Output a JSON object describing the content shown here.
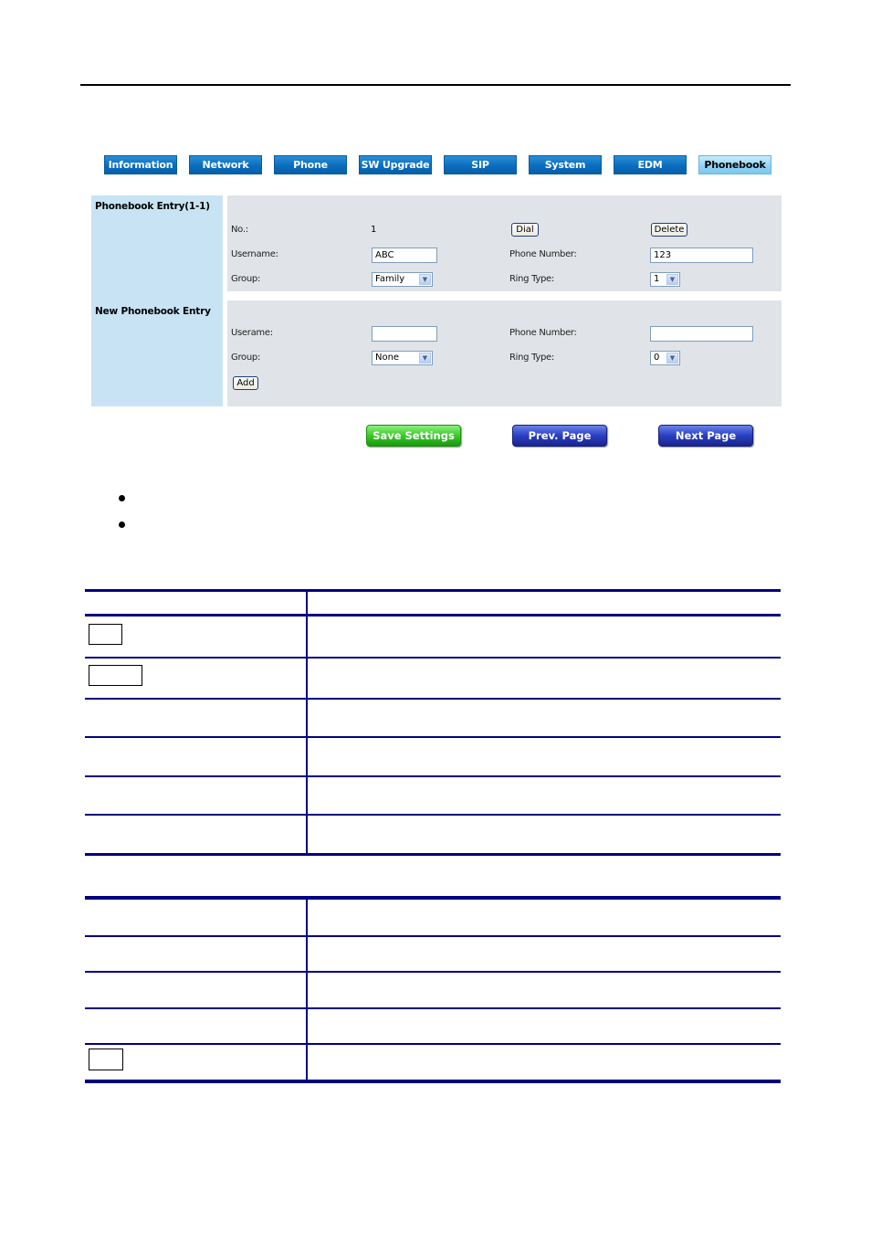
{
  "nav": {
    "tabs": [
      {
        "label": "Information",
        "active": false
      },
      {
        "label": "Network",
        "active": false
      },
      {
        "label": "Phone",
        "active": false
      },
      {
        "label": "SW Upgrade",
        "active": false
      },
      {
        "label": "SIP",
        "active": false
      },
      {
        "label": "System",
        "active": false
      },
      {
        "label": "EDM",
        "active": false
      },
      {
        "label": "Phonebook",
        "active": true
      }
    ]
  },
  "entry": {
    "title": "Phonebook Entry(1-1)",
    "no_label": "No.:",
    "no_value": "1",
    "dial_label": "Dial",
    "delete_label": "Delete",
    "username_label": "Username:",
    "username_value": "ABC",
    "phone_label": "Phone Number:",
    "phone_value": "123",
    "group_label": "Group:",
    "group_value": "Family",
    "ring_label": "Ring Type:",
    "ring_value": "1"
  },
  "new_entry": {
    "title": "New Phonebook Entry",
    "username_label": "Userame:",
    "username_value": "",
    "phone_label": "Phone Number:",
    "phone_value": "",
    "group_label": "Group:",
    "group_value": "None",
    "ring_label": "Ring Type:",
    "ring_value": "0",
    "add_label": "Add"
  },
  "actions": {
    "save_label": "Save Settings",
    "prev_label": "Prev. Page",
    "next_label": "Next Page"
  },
  "colors": {
    "tab_blue": "#0a6dbf",
    "tab_active": "#8fd2f3",
    "save_green": "#3cc82a",
    "nav_blue": "#2a3fc0",
    "table_rule": "#000080",
    "side_panel": "#c8e4f4",
    "form_panel": "#e0e4e8"
  },
  "bullets": [
    "",
    ""
  ],
  "table1": {
    "header": [
      "",
      ""
    ],
    "rows": [
      {
        "item": "",
        "desc": ""
      },
      {
        "item": "",
        "desc": ""
      },
      {
        "item": "",
        "desc": ""
      },
      {
        "item": "",
        "desc": ""
      },
      {
        "item": "",
        "desc": ""
      },
      {
        "item": "",
        "desc": ""
      }
    ]
  },
  "table2": {
    "rows": [
      {
        "item": "",
        "desc": ""
      },
      {
        "item": "",
        "desc": ""
      },
      {
        "item": "",
        "desc": ""
      },
      {
        "item": "",
        "desc": ""
      },
      {
        "item": "",
        "desc": ""
      }
    ]
  }
}
